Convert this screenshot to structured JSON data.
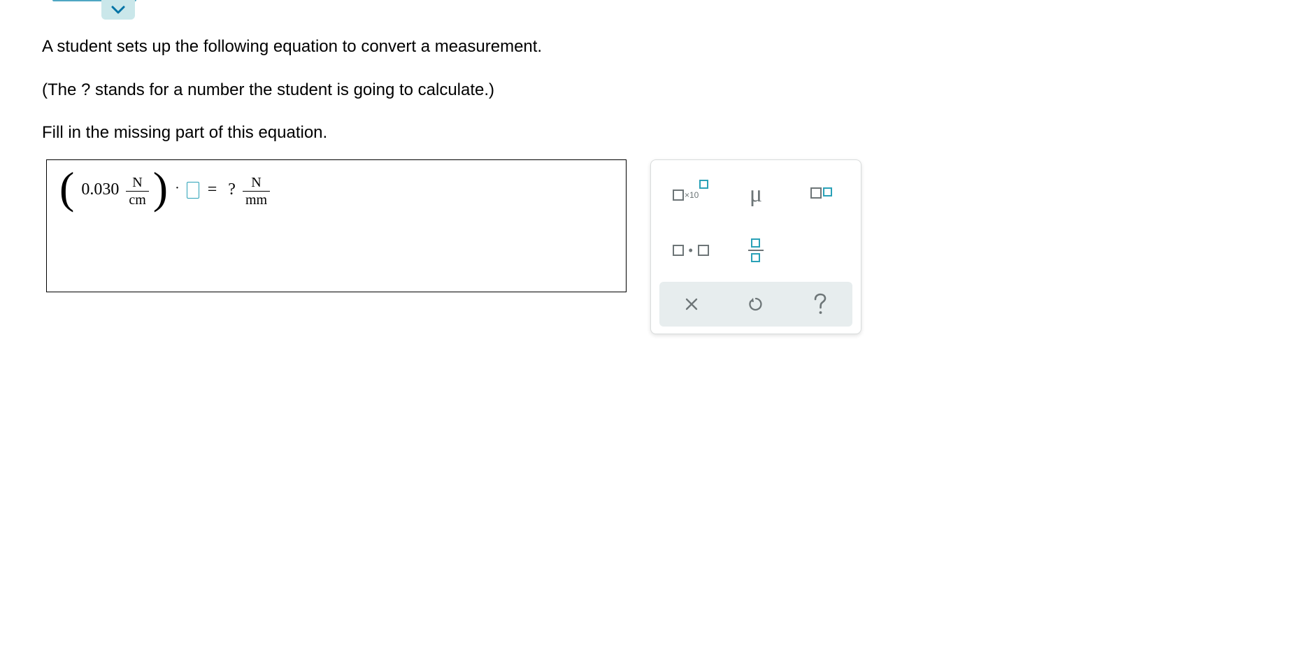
{
  "question": {
    "line1": "A student sets up the following equation to convert a measurement.",
    "line2": "(The ? stands for a number the student is going to calculate.)",
    "line3": "Fill in the missing part of this equation."
  },
  "equation": {
    "coefficient": "0.030",
    "left_frac_num": "N",
    "left_frac_den": "cm",
    "dot": "·",
    "equals": "=",
    "result_placeholder": "?",
    "right_frac_num": "N",
    "right_frac_den": "mm"
  },
  "toolbox": {
    "sci_label": "×10",
    "mu": "μ",
    "mult_dot": "•"
  }
}
